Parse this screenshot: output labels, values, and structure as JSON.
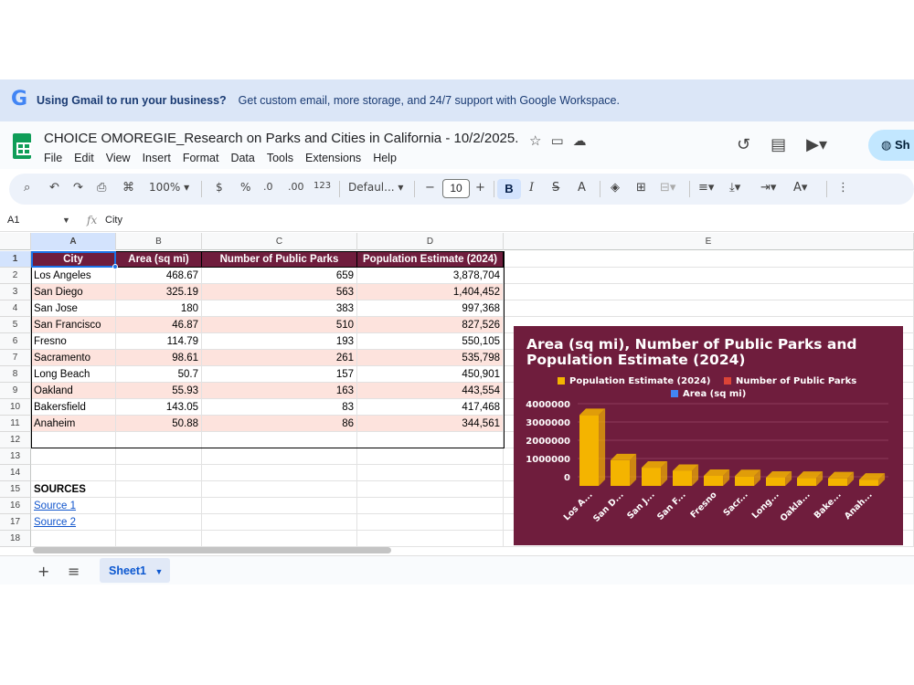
{
  "banner": {
    "logo": "G",
    "bold_text": "Using Gmail to run your business?",
    "rest_text": "Get custom email, more storage, and 24/7 support with Google Workspace."
  },
  "doc": {
    "title": "CHOICE OMOREGIE_Research on Parks and Cities in California - 10/2/2025.",
    "share_label": "Sh"
  },
  "menu": [
    "File",
    "Edit",
    "View",
    "Insert",
    "Format",
    "Data",
    "Tools",
    "Extensions",
    "Help"
  ],
  "toolbar": {
    "zoom": "100%",
    "currency": "$",
    "percent": "%",
    "decrease_decimal": ".0",
    "increase_decimal": ".00",
    "number_format": "123",
    "font": "Defaul...",
    "font_size": "10",
    "bold": "B",
    "italic": "I",
    "strike": "S",
    "text_color": "A"
  },
  "formula_bar": {
    "cell_ref": "A1",
    "fx": "fx",
    "content": "City"
  },
  "columns": [
    "A",
    "B",
    "C",
    "D",
    "E"
  ],
  "rows": [
    "1",
    "2",
    "3",
    "4",
    "5",
    "6",
    "7",
    "8",
    "9",
    "10",
    "11",
    "12",
    "13",
    "14",
    "15",
    "16",
    "17",
    "18"
  ],
  "table": {
    "headers": [
      "City",
      "Area (sq mi)",
      "Number of Public Parks",
      "Population Estimate (2024)"
    ],
    "rows": [
      [
        "Los Angeles",
        "468.67",
        "659",
        "3,878,704"
      ],
      [
        "San Diego",
        "325.19",
        "563",
        "1,404,452"
      ],
      [
        "San Jose",
        "180",
        "383",
        "997,368"
      ],
      [
        "San Francisco",
        "46.87",
        "510",
        "827,526"
      ],
      [
        "Fresno",
        "114.79",
        "193",
        "550,105"
      ],
      [
        "Sacramento",
        "98.61",
        "261",
        "535,798"
      ],
      [
        "Long Beach",
        "50.7",
        "157",
        "450,901"
      ],
      [
        "Oakland",
        "55.93",
        "163",
        "443,554"
      ],
      [
        "Bakersfield",
        "143.05",
        "83",
        "417,468"
      ],
      [
        "Anaheim",
        "50.88",
        "86",
        "344,561"
      ]
    ]
  },
  "sources": {
    "label": "SOURCES",
    "links": [
      "Source 1",
      "Source 2"
    ]
  },
  "sheet_tab": "Sheet1",
  "colors": {
    "header_bg": "#6f1d3d",
    "pink_row": "#fde3dd",
    "chart_bg": "#6f1d3d",
    "population": "#f4b400",
    "parks": "#db4437",
    "area": "#4285f4"
  },
  "chart_data": {
    "type": "bar",
    "title": "Area (sq mi), Number of Public Parks and Population Estimate (2024)",
    "categories": [
      "Los A...",
      "San D...",
      "San J...",
      "San F...",
      "Fresno",
      "Sacr...",
      "Long...",
      "Oakla...",
      "Bake...",
      "Anah..."
    ],
    "series": [
      {
        "name": "Population Estimate (2024)",
        "color": "#f4b400",
        "values": [
          3878704,
          1404452,
          997368,
          827526,
          550105,
          535798,
          450901,
          443554,
          417468,
          344561
        ]
      },
      {
        "name": "Number of Public Parks",
        "color": "#db4437",
        "values": [
          659,
          563,
          383,
          510,
          193,
          261,
          157,
          163,
          83,
          86
        ]
      },
      {
        "name": "Area (sq mi)",
        "color": "#4285f4",
        "values": [
          468.67,
          325.19,
          180,
          46.87,
          114.79,
          98.61,
          50.7,
          55.93,
          143.05,
          50.88
        ]
      }
    ],
    "y_ticks": [
      "0",
      "1000000",
      "2000000",
      "3000000",
      "4000000"
    ],
    "ylim": [
      0,
      4000000
    ],
    "legend_position": "top",
    "style": "3d-columns"
  }
}
